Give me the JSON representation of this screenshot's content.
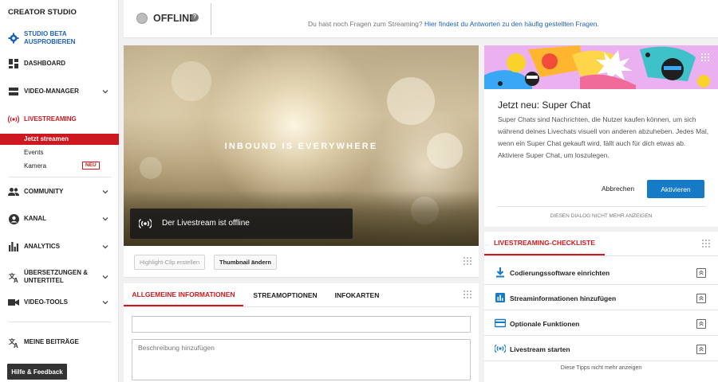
{
  "sidebar": {
    "title": "CREATOR STUDIO",
    "beta": "STUDIO BETA AUSPROBIEREN",
    "dashboard": "DASHBOARD",
    "video_manager": "VIDEO-MANAGER",
    "livestreaming": "LIVESTREAMING",
    "sub_items": [
      "Jetzt streamen",
      "Events",
      "Kamera"
    ],
    "new_badge": "NEU",
    "community": "COMMUNITY",
    "kanal": "KANAL",
    "analytics": "ANALYTICS",
    "translations": "ÜBERSETZUNGEN & UNTERTITEL",
    "video_tools": "VIDEO-TOOLS",
    "my_posts": "MEINE BEITRÄGE",
    "help": "Hilfe & Feedback"
  },
  "topbar": {
    "status": "OFFLINE",
    "faq_question": "Du hast noch Fragen zum Streaming?",
    "faq_link": "Hier findest du Antworten zu den häufig gestellten Fragen."
  },
  "preview": {
    "overlay_text": "INBOUND IS EVERYWHERE",
    "offline_message": "Der Livestream ist offline",
    "highlight_btn": "Highlight-Clip erstellen",
    "thumbnail_btn": "Thumbnail ändern"
  },
  "tabs": {
    "items": [
      "ALLGEMEINE INFORMATIONEN",
      "STREAMOPTIONEN",
      "INFOKARTEN"
    ],
    "title_value": "",
    "desc_placeholder": "Beschreibung hinzufügen"
  },
  "superchat": {
    "title": "Jetzt neu: Super Chat",
    "body": "Super Chats sind Nachrichten, die Nutzer kaufen können, um sich während deines Livechats visuell von anderen abzuheben. Jedes Mal, wenn ein Super Chat gekauft wird, fällt auch für dich etwas ab. Aktiviere Super Chat, um loszulegen.",
    "cancel": "Abbrechen",
    "activate": "Aktivieren",
    "dismiss": "DIESEN DIALOG NICHT MEHR ANZEIGEN"
  },
  "checklist": {
    "title": "LIVESTREAMING-CHECKLISTE",
    "items": [
      "Codierungssoftware einrichten",
      "Streaminformationen hinzufügen",
      "Optionale Funktionen",
      "Livestream starten"
    ],
    "dismiss": "Diese Tipps nicht mehr anzeigen"
  },
  "colors": {
    "accent_red": "#cc181e",
    "link_blue": "#1c62b9",
    "button_blue": "#167ac6"
  }
}
